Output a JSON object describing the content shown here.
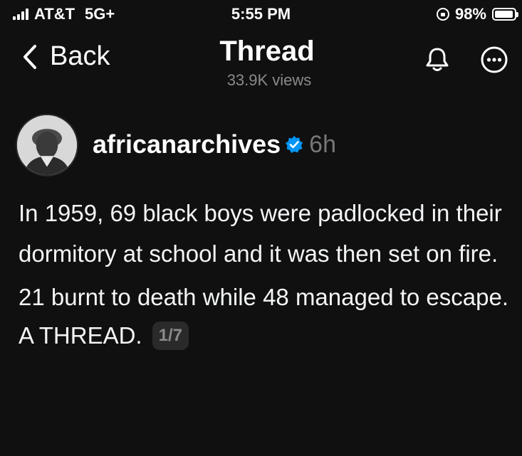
{
  "status_bar": {
    "carrier": "AT&T",
    "network": "5G+",
    "time": "5:55 PM",
    "battery": "98%",
    "battery_level": 0.98
  },
  "nav": {
    "back_label": "Back",
    "title": "Thread",
    "views": "33.9K views"
  },
  "post": {
    "username": "africanarchives",
    "verified": true,
    "time_ago": "6h",
    "paragraphs": [
      "In 1959, 69 black boys were padlocked in their dormitory at school and it was then set on fire.",
      "21 burnt to death while 48 managed to escape."
    ],
    "closing": "A THREAD.",
    "counter": "1/7"
  },
  "colors": {
    "background": "#101010",
    "text": "#f3f5f7",
    "muted": "#777777",
    "verified_blue": "#0095f6",
    "counter_bg": "#2a2a2a"
  },
  "icons": [
    "signal-icon",
    "orientation-lock-icon",
    "battery-icon",
    "back-chevron-icon",
    "bell-icon",
    "more-options-icon",
    "verified-badge-icon"
  ]
}
